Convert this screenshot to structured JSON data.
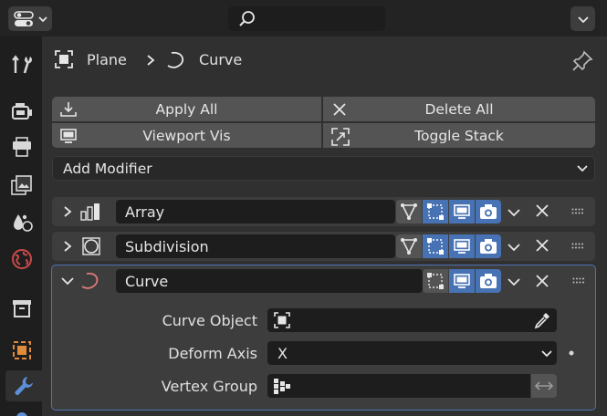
{
  "breadcrumb": {
    "object": "Plane",
    "modifier": "Curve"
  },
  "actions": {
    "apply_all": "Apply All",
    "delete_all": "Delete All",
    "viewport_vis": "Viewport Vis",
    "toggle_stack": "Toggle Stack",
    "add_modifier": "Add Modifier"
  },
  "modifiers": [
    {
      "name": "Array",
      "icon": "array-modifier-icon",
      "expanded": false
    },
    {
      "name": "Subdivision",
      "icon": "subdivision-modifier-icon",
      "expanded": false
    },
    {
      "name": "Curve",
      "icon": "curve-modifier-icon",
      "expanded": true
    }
  ],
  "curve_props": {
    "curve_object_label": "Curve Object",
    "deform_axis_label": "Deform Axis",
    "deform_axis_value": "X",
    "vertex_group_label": "Vertex Group"
  },
  "colors": {
    "accent": "#4772b3",
    "panel_border": "#4f74b4",
    "curve_icon": "#e07a7a",
    "object_tab": "#e08a3c",
    "physics_tab": "#c94a4a"
  },
  "tabs": [
    "tool-icon",
    "render-icon",
    "output-icon",
    "view-layer-icon",
    "scene-icon",
    "world-icon",
    "collection-icon",
    "object-icon",
    "modifier-icon"
  ]
}
